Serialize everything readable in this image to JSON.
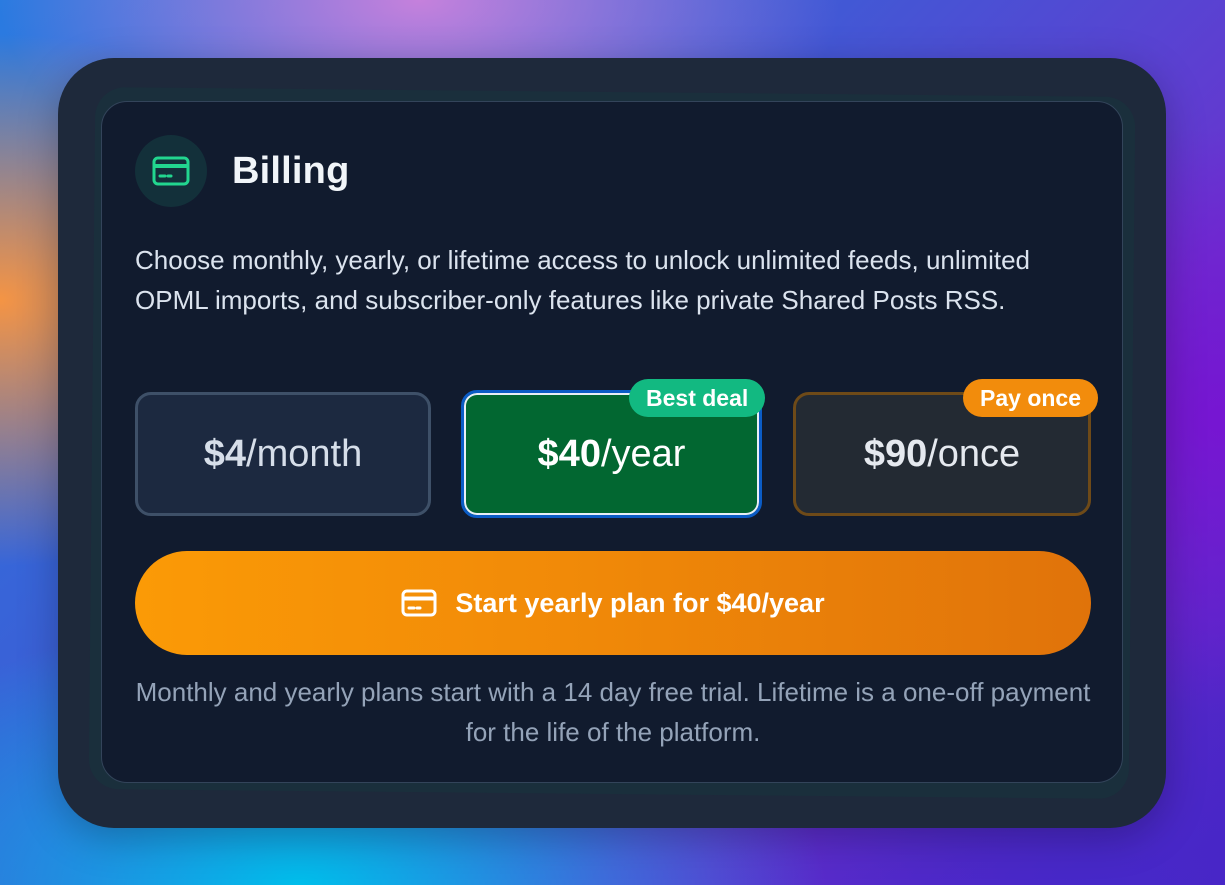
{
  "card": {
    "icon": "credit-card-icon",
    "title": "Billing",
    "description": "Choose monthly, yearly, or lifetime access to unlock unlimited feeds, unlimited OPML imports, and subscriber-only features like private Shared Posts RSS."
  },
  "plans": [
    {
      "price": "$4",
      "period": "/month",
      "selected": false
    },
    {
      "price": "$40",
      "period": "/year",
      "selected": true,
      "badge": "Best deal"
    },
    {
      "price": "$90",
      "period": "/once",
      "selected": false,
      "badge": "Pay once"
    }
  ],
  "cta": {
    "icon": "credit-card-icon",
    "label": "Start yearly plan for $40/year"
  },
  "footnote": "Monthly and yearly plans start with a 14 day free trial. Lifetime is a one-off payment for the life of the platform.",
  "colors": {
    "accent_green": "#12b981",
    "selected_plan": "#026731",
    "cta_orange": "#fb9a06",
    "badge_orange": "#f28c0c",
    "panel_bg": "#111b2e"
  }
}
